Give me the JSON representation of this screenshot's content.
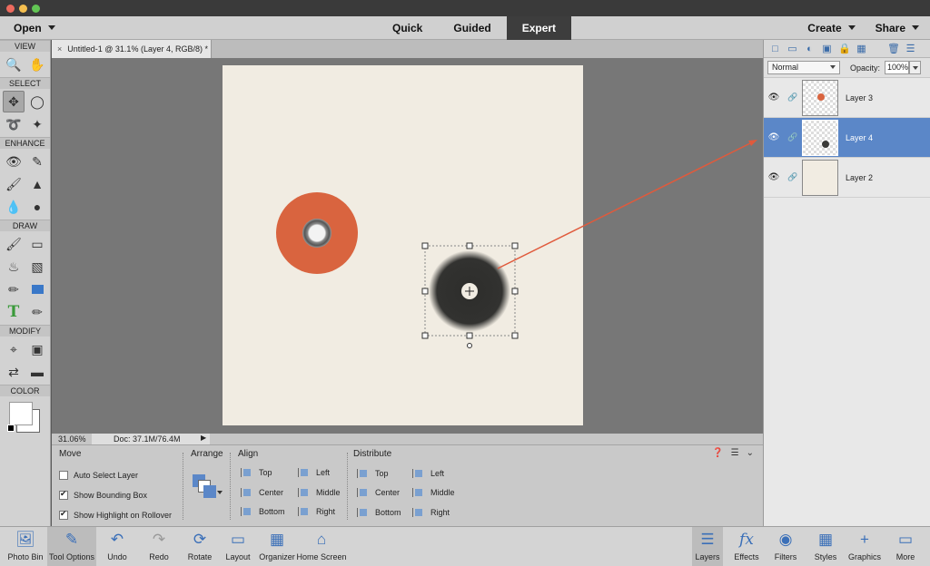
{
  "topbar": {
    "open": "Open",
    "modes": [
      "Quick",
      "Guided",
      "Expert"
    ],
    "active_mode": "Expert",
    "create": "Create",
    "share": "Share"
  },
  "toolbox": {
    "sections": {
      "view": "VIEW",
      "select": "SELECT",
      "enhance": "ENHANCE",
      "draw": "DRAW",
      "modify": "MODIFY",
      "color": "COLOR"
    }
  },
  "document": {
    "tab_title": "Untitled-1 @ 31.1% (Layer 4, RGB/8) *",
    "zoom": "31.06%",
    "doc_size": "Doc: 37.1M/76.4M"
  },
  "layers": {
    "blend_mode": "Normal",
    "opacity_label": "Opacity:",
    "opacity_value": "100%",
    "items": [
      {
        "name": "Layer 3"
      },
      {
        "name": "Layer 4"
      },
      {
        "name": "Layer 2"
      }
    ]
  },
  "tool_options": {
    "tool_name": "Move",
    "auto_select": "Auto Select Layer",
    "show_bounding": "Show Bounding Box",
    "show_highlight": "Show Highlight on Rollover",
    "arrange": "Arrange",
    "align": "Align",
    "align_items": [
      "Top",
      "Center",
      "Bottom",
      "Left",
      "Middle",
      "Right"
    ],
    "distribute": "Distribute",
    "distribute_items": [
      "Top",
      "Center",
      "Bottom",
      "Left",
      "Middle",
      "Right"
    ]
  },
  "taskbar": {
    "photo_bin": "Photo Bin",
    "tool_options": "Tool Options",
    "undo": "Undo",
    "redo": "Redo",
    "rotate": "Rotate",
    "layout": "Layout",
    "organizer": "Organizer",
    "home_screen": "Home Screen",
    "layers": "Layers",
    "effects": "Effects",
    "filters": "Filters",
    "styles": "Styles",
    "graphics": "Graphics",
    "more": "More"
  },
  "colors": {
    "accent": "#5b87c8",
    "annotation_arrow": "#e05a3c",
    "orange_disc": "#d9643f"
  }
}
